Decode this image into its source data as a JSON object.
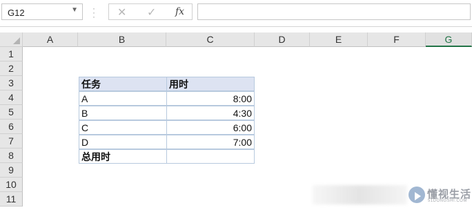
{
  "formula_bar": {
    "name_box": "G12",
    "fx_label": "fx",
    "cancel_icon": "✕",
    "enter_icon": "✓",
    "formula": ""
  },
  "columns": [
    "A",
    "B",
    "C",
    "D",
    "E",
    "F",
    "G"
  ],
  "selected_column": "G",
  "rows": [
    "1",
    "2",
    "3",
    "4",
    "5",
    "6",
    "7",
    "8",
    "9",
    "10",
    "11"
  ],
  "table": {
    "header": {
      "task": "任务",
      "time": "用时"
    },
    "items": [
      {
        "task": "A",
        "time": "8:00"
      },
      {
        "task": "B",
        "time": "4:30"
      },
      {
        "task": "C",
        "time": "6:00"
      },
      {
        "task": "D",
        "time": "7:00"
      }
    ],
    "total": {
      "label": "总用时",
      "time": ""
    }
  },
  "watermark": {
    "name": "懂视生活",
    "sub": "51DONGSHI.COM"
  },
  "colors": {
    "header_fill": "#dde3f2",
    "border": "#b7c9de",
    "selected_column": "#217346"
  }
}
